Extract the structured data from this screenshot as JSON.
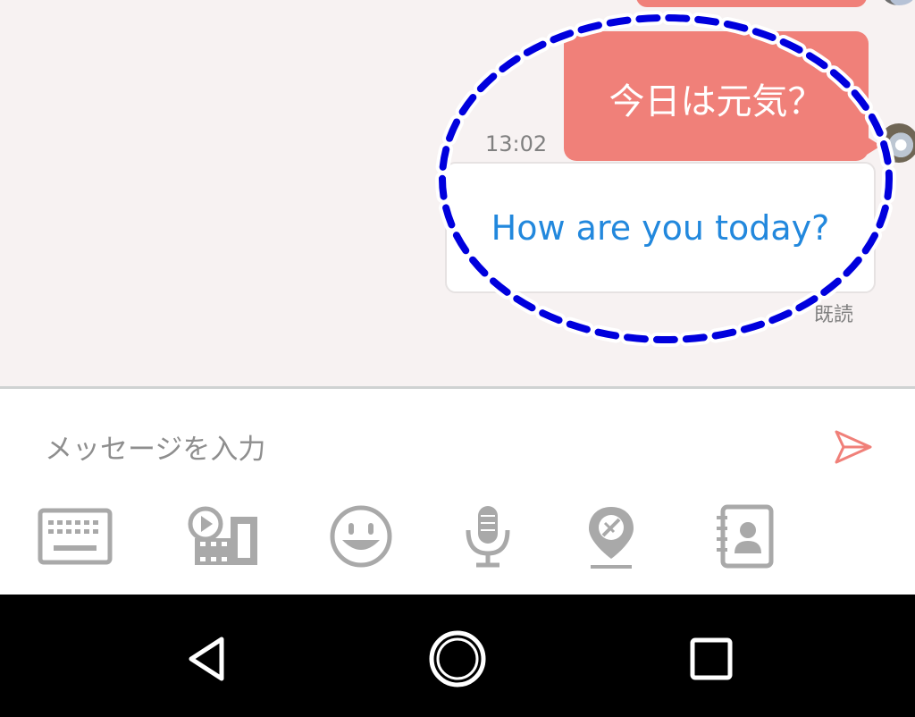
{
  "chat": {
    "messages": [
      {
        "text": "今日は元気？",
        "side": "right"
      },
      {
        "time": "13:02",
        "text": "How are you today?",
        "status": "既読"
      }
    ]
  },
  "input": {
    "placeholder": "メッセージを入力",
    "value": ""
  },
  "toolbar": {
    "icons": [
      "keyboard-icon",
      "video-gallery-icon",
      "emoji-icon",
      "microphone-icon",
      "location-icon",
      "contacts-icon"
    ]
  },
  "navbar": {
    "icons": [
      "back-icon",
      "home-icon",
      "recents-icon"
    ]
  },
  "colors": {
    "accent_pink": "#f08079",
    "link_blue": "#2288dd",
    "highlight_blue": "#0000dd",
    "icon_gray": "#a9a9a9",
    "chat_bg": "#f7f2f2"
  }
}
